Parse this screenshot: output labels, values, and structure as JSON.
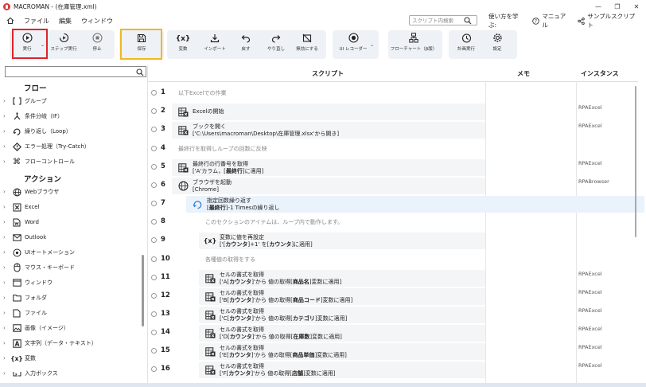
{
  "window": {
    "title": "MACROMAN - (在庫管理.xml)",
    "controls": [
      "—",
      "❐",
      "✕"
    ]
  },
  "menu": {
    "items": [
      "ファイル",
      "編集",
      "ウィンドウ"
    ]
  },
  "search": {
    "placeholder": "スクリプト内検索"
  },
  "top_links": {
    "learn": "使い方を学ぶ:",
    "manual": "マニュアル",
    "samples": "サンプルスクリプト"
  },
  "toolbar": {
    "run": "実行",
    "step_run": "ステップ実行",
    "stop": "停止",
    "save": "保存",
    "variables": "変数",
    "import": "インポート",
    "undo": "戻す",
    "redo": "やり直し",
    "disable": "無効にする",
    "ui_recorder": "UI レコーダー",
    "flowchart": "フローチャート（β版）",
    "schedule": "計画実行",
    "settings": "設定"
  },
  "sidebar": {
    "flow_title": "フロー",
    "flow_items": [
      "グループ",
      "条件分岐（IF）",
      "繰り返し（Loop）",
      "エラー処理（Try-Catch）",
      "フローコントロール"
    ],
    "action_title": "アクション",
    "action_items": [
      "Webブラウザ",
      "Excel",
      "Word",
      "Outlook",
      "UIオートメーション",
      "マウス・キーボード",
      "ウィンドウ",
      "フォルダ",
      "ファイル",
      "画像（イメージ）",
      "文字列（データ・テキスト）",
      "変数",
      "入力ボックス"
    ]
  },
  "columns": {
    "script": "スクリプト",
    "memo": "メモ",
    "instance": "インスタンス"
  },
  "rows": [
    {
      "num": "1",
      "kind": "comment",
      "text": "以下Excelでの作業"
    },
    {
      "num": "2",
      "kind": "action",
      "icon": "excel-action-icon",
      "line1": "Excelの開始",
      "line2": "",
      "instance": "RPAExcel"
    },
    {
      "num": "3",
      "kind": "action",
      "icon": "excel-action-icon",
      "line1": "ブックを開く",
      "line2": "['C:\\Users\\macroman\\Desktop\\在庫管理.xlsx'から開き]",
      "instance": "RPAExcel"
    },
    {
      "num": "4",
      "kind": "comment",
      "text": "最終行を取得しループの回数に反映"
    },
    {
      "num": "5",
      "kind": "action",
      "icon": "excel-action-icon",
      "line1": "最終行の行番号を取得",
      "line2_parts": [
        "['A'カラム，[",
        "最終行",
        "]に適用]"
      ],
      "instance": "RPAExcel"
    },
    {
      "num": "6",
      "kind": "action",
      "icon": "globe-icon",
      "line1": "ブラウザを起動",
      "line2": "[Chrome]",
      "instance": "RPABrowser"
    },
    {
      "num": "7",
      "kind": "loop",
      "icon": "loop-icon",
      "line1": "指定回数繰り返す",
      "line2_parts": [
        "[",
        "最終行",
        "]-1 Timesの繰り返し"
      ],
      "instance": ""
    },
    {
      "num": "8",
      "kind": "comment",
      "text": "このセクションのアイテムは、ループ内で動作します。"
    },
    {
      "num": "9",
      "kind": "action",
      "icon": "variable-icon",
      "line1": "変数に値を再設定",
      "line2_parts": [
        "['[",
        "カウンタ",
        "]+1' を[",
        "カウンタ",
        "]に適用]"
      ],
      "instance": ""
    },
    {
      "num": "10",
      "kind": "comment",
      "text": "各種値の取得をする"
    },
    {
      "num": "11",
      "kind": "action",
      "icon": "excel-action-icon",
      "line1": "セルの書式を取得",
      "line2_parts": [
        "['A[",
        "カウンタ",
        "]'から 値の取得[",
        "商品名",
        "]変数に適用]"
      ],
      "instance": "RPAExcel"
    },
    {
      "num": "12",
      "kind": "action",
      "icon": "excel-action-icon",
      "line1": "セルの書式を取得",
      "line2_parts": [
        "['B[",
        "カウンタ",
        "]'から 値の取得[",
        "商品コード",
        "]変数に適用]"
      ],
      "instance": "RPAExcel"
    },
    {
      "num": "13",
      "kind": "action",
      "icon": "excel-action-icon",
      "line1": "セルの書式を取得",
      "line2_parts": [
        "['C[",
        "カウンタ",
        "]'から 値の取得[",
        "カテゴリ",
        "]変数に適用]"
      ],
      "instance": "RPAExcel"
    },
    {
      "num": "14",
      "kind": "action",
      "icon": "excel-action-icon",
      "line1": "セルの書式を取得",
      "line2_parts": [
        "['D[",
        "カウンタ",
        "]'から 値の取得[",
        "在庫数",
        "]変数に適用]"
      ],
      "instance": "RPAExcel"
    },
    {
      "num": "15",
      "kind": "action",
      "icon": "excel-action-icon",
      "line1": "セルの書式を取得",
      "line2_parts": [
        "['E[",
        "カウンタ",
        "]'から 値の取得[",
        "商品単価",
        "]変数に適用]"
      ],
      "instance": "RPAExcel"
    },
    {
      "num": "16",
      "kind": "action",
      "icon": "excel-action-icon",
      "line1": "セルの書式を取得",
      "line2_parts": [
        "['F[",
        "カウンタ",
        "]'から 値の取得[",
        "店舗",
        "]変数に適用]"
      ],
      "instance": "RPAExcel"
    }
  ]
}
